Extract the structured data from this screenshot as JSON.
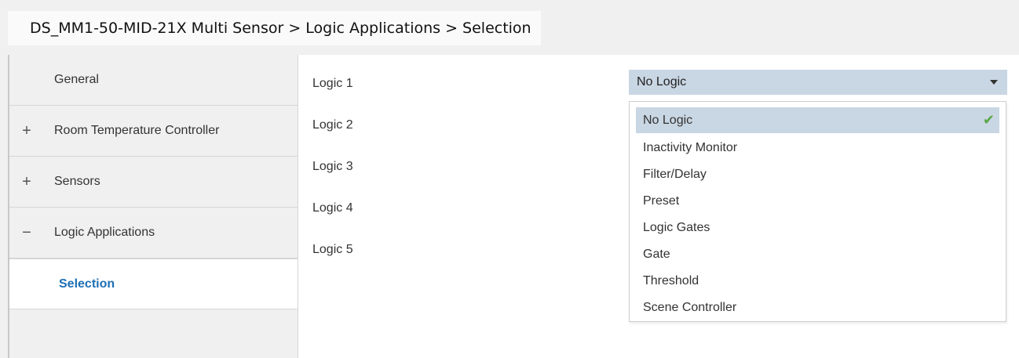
{
  "breadcrumb": "DS_MM1-50-MID-21X Multi Sensor > Logic Applications > Selection",
  "sidebar": {
    "items": [
      {
        "expander": "",
        "label": "General"
      },
      {
        "expander": "+",
        "label": "Room Temperature Controller"
      },
      {
        "expander": "+",
        "label": "Sensors"
      },
      {
        "expander": "−",
        "label": "Logic Applications"
      },
      {
        "expander": "",
        "label": "Selection"
      }
    ]
  },
  "main": {
    "rows": [
      "Logic 1",
      "Logic 2",
      "Logic 3",
      "Logic 4",
      "Logic 5"
    ],
    "select": {
      "value": "No Logic"
    },
    "dropdown": {
      "options": [
        "No Logic",
        "Inactivity Monitor",
        "Filter/Delay",
        "Preset",
        "Logic Gates",
        "Gate",
        "Threshold",
        "Scene Controller"
      ],
      "selected_check": "✔"
    }
  },
  "colors": {
    "selected_text": "#1e6fb4",
    "select_bg": "#c9d6e3",
    "check": "#5aa84a"
  }
}
